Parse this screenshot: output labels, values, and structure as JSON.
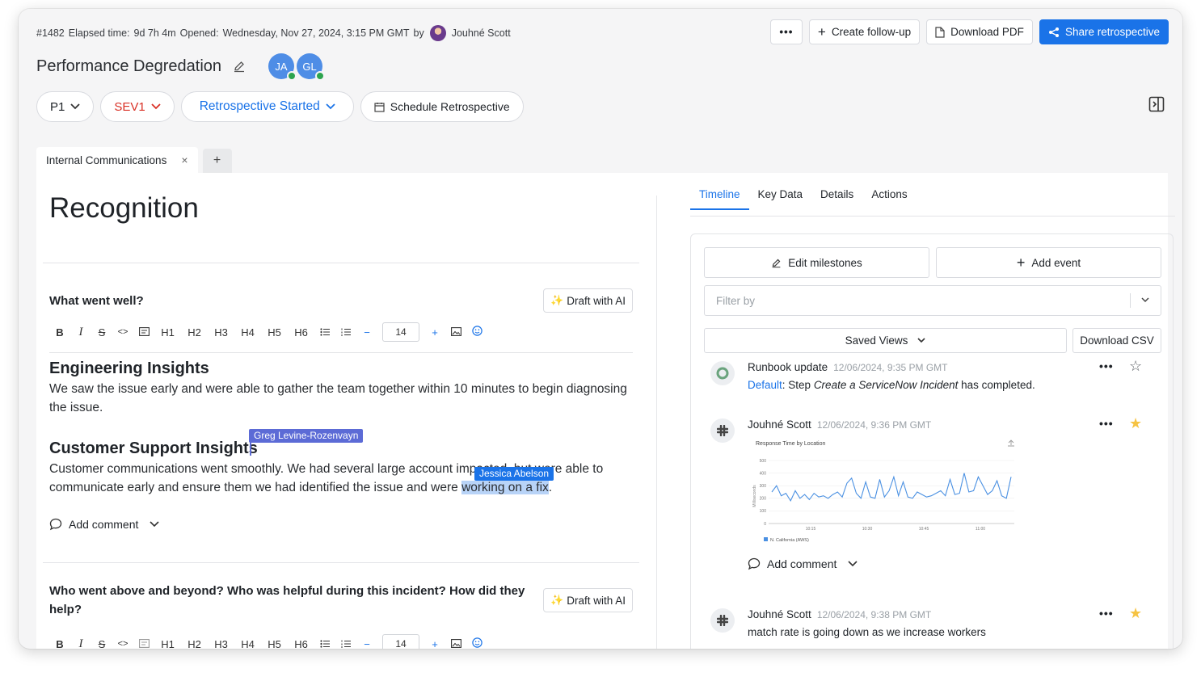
{
  "header": {
    "incident_id": "#1482",
    "elapsed_label": "Elapsed time:",
    "elapsed_value": "9d 7h 4m",
    "opened_label": "Opened:",
    "opened_value": "Wednesday, Nov 27, 2024, 3:15 PM GMT",
    "by_label": "by",
    "owner": "Jouhné Scott",
    "actions": {
      "more": "•••",
      "follow_up": "Create follow-up",
      "download_pdf": "Download PDF",
      "share": "Share retrospective"
    }
  },
  "incident": {
    "title": "Performance Degredation",
    "participants": [
      {
        "initials": "JA",
        "status_color": "#2da44e"
      },
      {
        "initials": "GL",
        "status_color": "#2da44e"
      }
    ]
  },
  "pills": {
    "priority": "P1",
    "severity": "SEV1",
    "status": "Retrospective Started",
    "schedule": "Schedule Retrospective"
  },
  "doc_tabs": {
    "active": "Internal Communications",
    "close": "×",
    "add": "+"
  },
  "editor": {
    "page_heading": "Recognition",
    "section1": {
      "question": "What went well?",
      "draft_label": "Draft with AI",
      "heading1": "Engineering Insights",
      "para1": "We saw the issue early and were able to gather the team together within 10 minutes to begin diagnosing the issue.",
      "heading2": "Customer Support Insights",
      "para2_line1": "Customer communications went smoothly. We had several large account impacted, but were able to",
      "para2_line2_pre": "communicate early and ensure them we had identified the issue and were ",
      "para2_line2_hl": "working on a fix",
      "para2_line2_post": ".",
      "cursor1_name": "Greg Levine-Rozenvayn",
      "cursor2_name": "Jessica Abelson",
      "add_comment": "Add comment"
    },
    "section2": {
      "question_line1": "Who went above and beyond? Who was helpful during this incident? How did they",
      "question_line2": "help?",
      "draft_label": "Draft with AI"
    },
    "toolbar": {
      "bold": "B",
      "italic": "I",
      "strike": "S",
      "code": "<>",
      "h1": "H1",
      "h2": "H2",
      "h3": "H3",
      "h4": "H4",
      "h5": "H5",
      "h6": "H6",
      "minus": "−",
      "size": "14",
      "plus": "+"
    }
  },
  "right_panel": {
    "tabs": [
      "Timeline",
      "Key Data",
      "Details",
      "Actions"
    ],
    "edit_milestones": "Edit milestones",
    "add_event": "Add event",
    "filter_placeholder": "Filter by",
    "saved_views": "Saved Views",
    "download_csv": "Download CSV",
    "events": [
      {
        "author": "Runbook update",
        "time": "12/06/2024, 9:35 PM GMT",
        "body_link": "Default",
        "body_text1": ": Step ",
        "body_em": "Create a ServiceNow Incident",
        "body_text2": " has completed.",
        "starred": false
      },
      {
        "author": "Jouhné Scott",
        "time": "12/06/2024, 9:36 PM GMT",
        "add_comment": "Add comment",
        "starred": true
      },
      {
        "author": "Jouhné Scott",
        "time": "12/06/2024, 9:38 PM GMT",
        "body": "match rate is going down as we increase workers",
        "starred": true
      }
    ]
  },
  "chart_data": {
    "type": "line",
    "title": "Response Time by Location",
    "ylabel": "Milliseconds",
    "ylim": [
      0,
      500
    ],
    "yticks": [
      0,
      100,
      200,
      300,
      400,
      500
    ],
    "xticks": [
      "10:15",
      "10:30",
      "10:45",
      "11:00"
    ],
    "series": [
      {
        "name": "N. California (AWS)",
        "color": "#4a90e2",
        "values": [
          250,
          300,
          220,
          240,
          180,
          260,
          200,
          230,
          190,
          240,
          210,
          220,
          200,
          230,
          250,
          210,
          320,
          360,
          240,
          200,
          330,
          210,
          200,
          350,
          210,
          260,
          370,
          220,
          330,
          210,
          200,
          250,
          230,
          210,
          220,
          240,
          260,
          220,
          350,
          230,
          240,
          400,
          250,
          260,
          370,
          300,
          230,
          260,
          340,
          220,
          200,
          370
        ]
      }
    ]
  },
  "colors": {
    "accent": "#1a73e8",
    "severity": "#d93025",
    "star": "#f6c343",
    "cursor_greg": "#5c6bd6",
    "cursor_jessica": "#1a73e8"
  }
}
